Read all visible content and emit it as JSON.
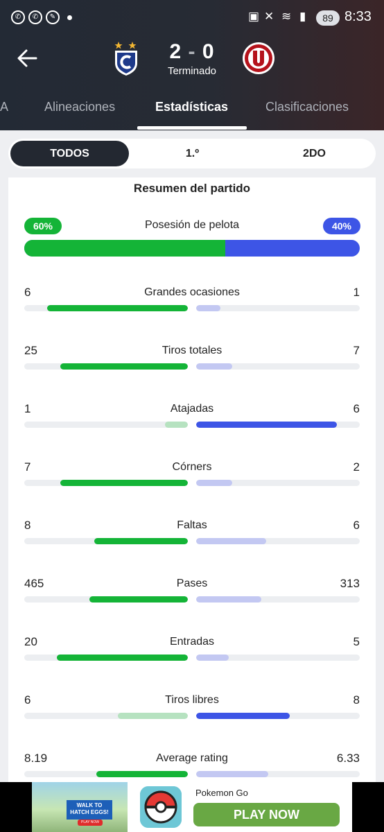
{
  "status_bar": {
    "battery": "89",
    "time": "8:33"
  },
  "match": {
    "score": "2 - 0",
    "home_score": "2",
    "separator": "-",
    "away_score": "0",
    "status": "Terminado"
  },
  "tabs": [
    {
      "label": "A"
    },
    {
      "label": "Alineaciones"
    },
    {
      "label": "Estadísticas"
    },
    {
      "label": "Clasificaciones"
    }
  ],
  "segments": [
    {
      "label": "TODOS"
    },
    {
      "label": "1.º"
    },
    {
      "label": "2DO"
    }
  ],
  "summary": {
    "title": "Resumen del partido",
    "possession": {
      "label": "Posesión de pelota",
      "home": "60%",
      "away": "40%",
      "home_fraction": 0.6
    },
    "stats": [
      {
        "label": "Grandes ocasiones",
        "home": "6",
        "away": "1",
        "home_fraction": 0.86,
        "away_fraction": 0.15,
        "leader": "home"
      },
      {
        "label": "Tiros totales",
        "home": "25",
        "away": "7",
        "home_fraction": 0.78,
        "away_fraction": 0.22,
        "leader": "home"
      },
      {
        "label": "Atajadas",
        "home": "1",
        "away": "6",
        "home_fraction": 0.14,
        "away_fraction": 0.86,
        "leader": "away"
      },
      {
        "label": "Córners",
        "home": "7",
        "away": "2",
        "home_fraction": 0.78,
        "away_fraction": 0.22,
        "leader": "home"
      },
      {
        "label": "Faltas",
        "home": "8",
        "away": "6",
        "home_fraction": 0.57,
        "away_fraction": 0.43,
        "leader": "home"
      },
      {
        "label": "Pases",
        "home": "465",
        "away": "313",
        "home_fraction": 0.6,
        "away_fraction": 0.4,
        "leader": "home"
      },
      {
        "label": "Entradas",
        "home": "20",
        "away": "5",
        "home_fraction": 0.8,
        "away_fraction": 0.2,
        "leader": "home"
      },
      {
        "label": "Tiros libres",
        "home": "6",
        "away": "8",
        "home_fraction": 0.43,
        "away_fraction": 0.57,
        "leader": "away"
      },
      {
        "label": "Average rating",
        "home": "8.19",
        "away": "6.33",
        "home_fraction": 0.56,
        "away_fraction": 0.44,
        "leader": "home"
      }
    ]
  },
  "ad": {
    "banner_text": "WALK TO HATCH EGGS!",
    "small_button": "PLAY NOW",
    "title": "Pokemon Go",
    "cta": "PLAY NOW"
  },
  "colors": {
    "home_strong": "#14b437",
    "home_light": "#b6e2c0",
    "away_strong": "#3d55e6",
    "away_light": "#c3c8f2"
  }
}
